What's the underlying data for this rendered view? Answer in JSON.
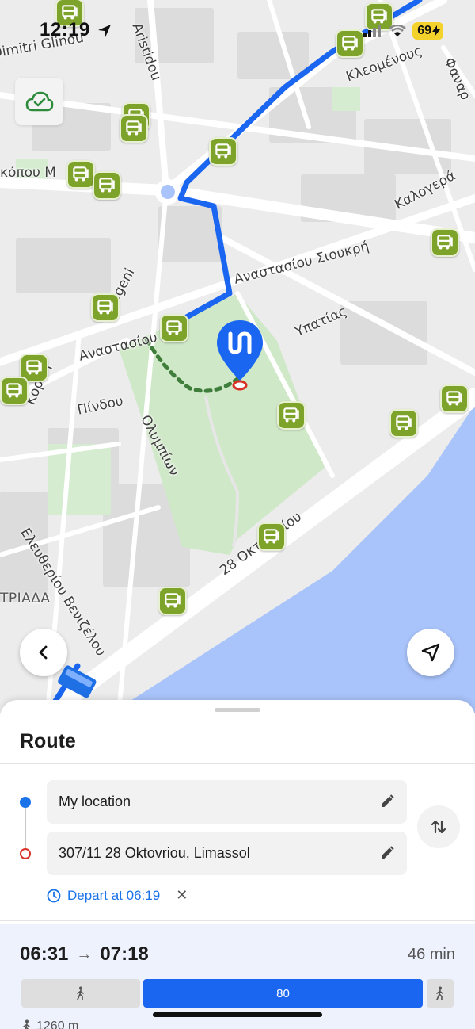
{
  "status_bar": {
    "time": "12:19",
    "battery": "69",
    "location_icon": "location-arrow-icon",
    "signal_icon": "cellular-signal-icon",
    "wifi_icon": "wifi-icon"
  },
  "map": {
    "streets": [
      "Κλεομένους",
      "Καλογερά",
      "Αναστασίου Σιουκρή",
      "Υπατίας",
      "Αναστασίου",
      "Πίνδου",
      "Ολυμπίων",
      "Κοραή",
      "28 Οκτωβρίου",
      "Ελευθερίου Βενιζέλου",
      "Digeni",
      "Φαναρ",
      "Aristidou",
      "Dimitri Glinou",
      "κόπου Μ"
    ],
    "district": "ΤΡΙΑΔΑ",
    "colors": {
      "route": "#1a66f0",
      "walk": "#3f7d3a",
      "park": "#cfe8c7",
      "sea": "#a9c4fb",
      "bus_stop": "#7ea32b"
    },
    "sync_icon": "cloud-check-icon",
    "back_icon": "chevron-left-icon",
    "locate_icon": "navigation-arrow-icon",
    "destination_icon": "destination-pin-icon"
  },
  "route_panel": {
    "title": "Route",
    "origin": "My location",
    "destination": "307/11 28 Oktovriou, Limassol",
    "depart_label": "Depart at 06:19",
    "clear_symbol": "✕",
    "swap_icon": "swap-vertical-icon",
    "edit_icon": "pencil-icon"
  },
  "result": {
    "start_time": "06:31",
    "arrow": "→",
    "end_time": "07:18",
    "duration": "46 min",
    "bus_line": "80",
    "walk_distance": "1260 m"
  }
}
